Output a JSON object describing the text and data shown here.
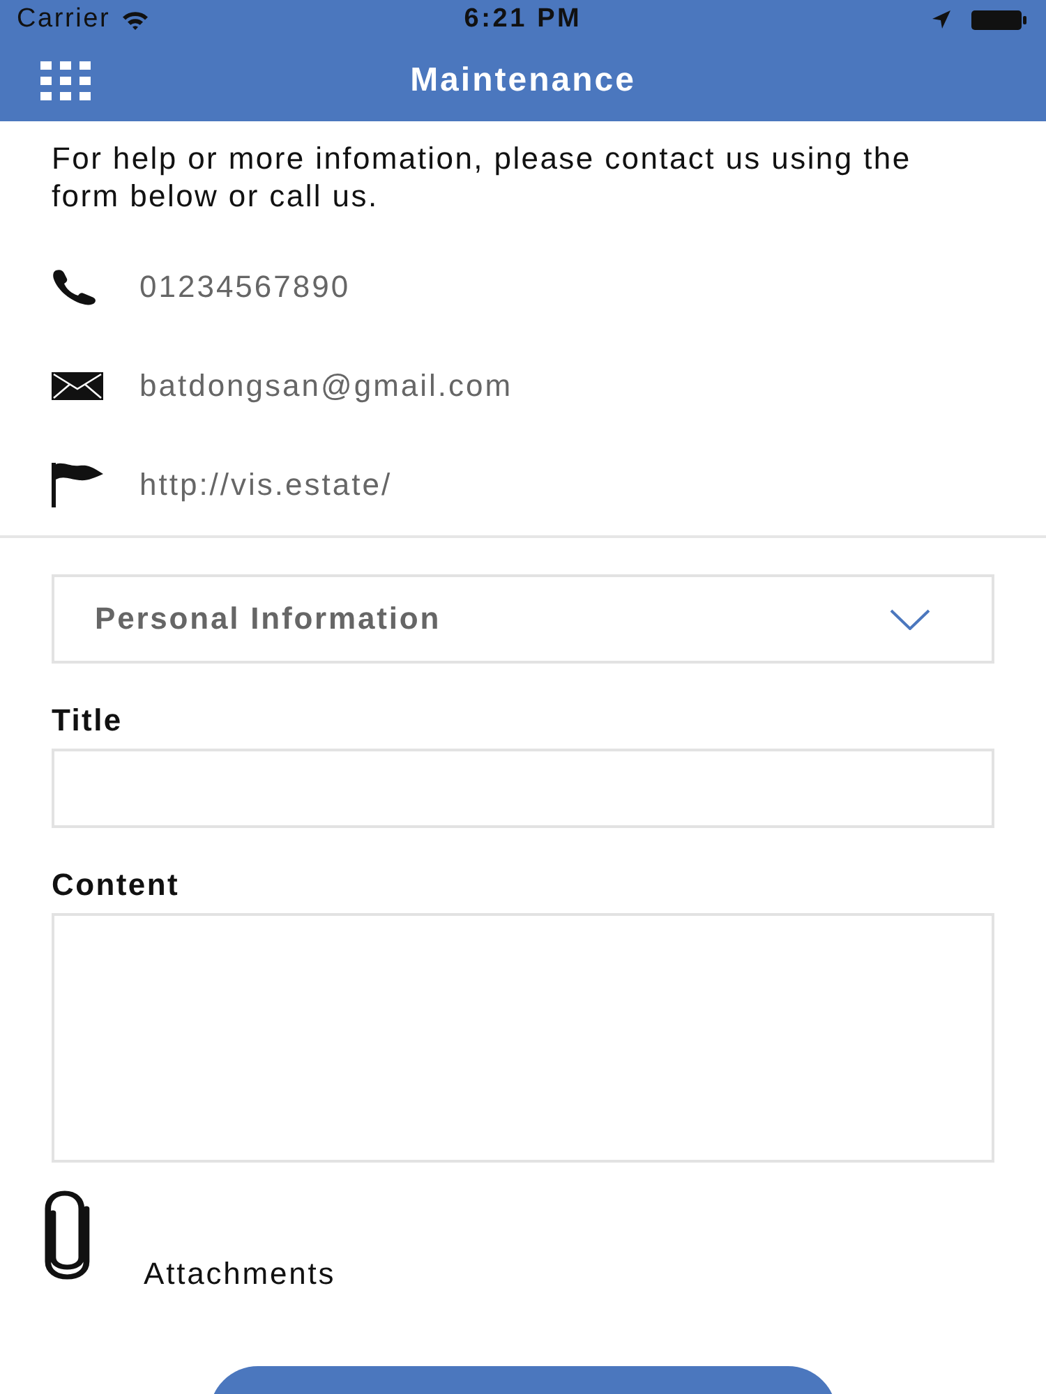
{
  "status_bar": {
    "carrier": "Carrier",
    "time": "6:21 PM"
  },
  "nav_bar": {
    "title": "Maintenance"
  },
  "intro": "For help or more infomation, please contact us using the form below or call us.",
  "contacts": [
    {
      "kind": "phone",
      "text": "01234567890"
    },
    {
      "kind": "email",
      "text": "batdongsan@gmail.com"
    },
    {
      "kind": "website",
      "text": "http://vis.estate/"
    }
  ],
  "accordion": {
    "label": "Personal Information",
    "expanded": false
  },
  "fields": [
    {
      "kind": "line",
      "label": "Title"
    },
    {
      "kind": "area",
      "label": "Content"
    }
  ],
  "attachments": {
    "label": "Attachments"
  }
}
